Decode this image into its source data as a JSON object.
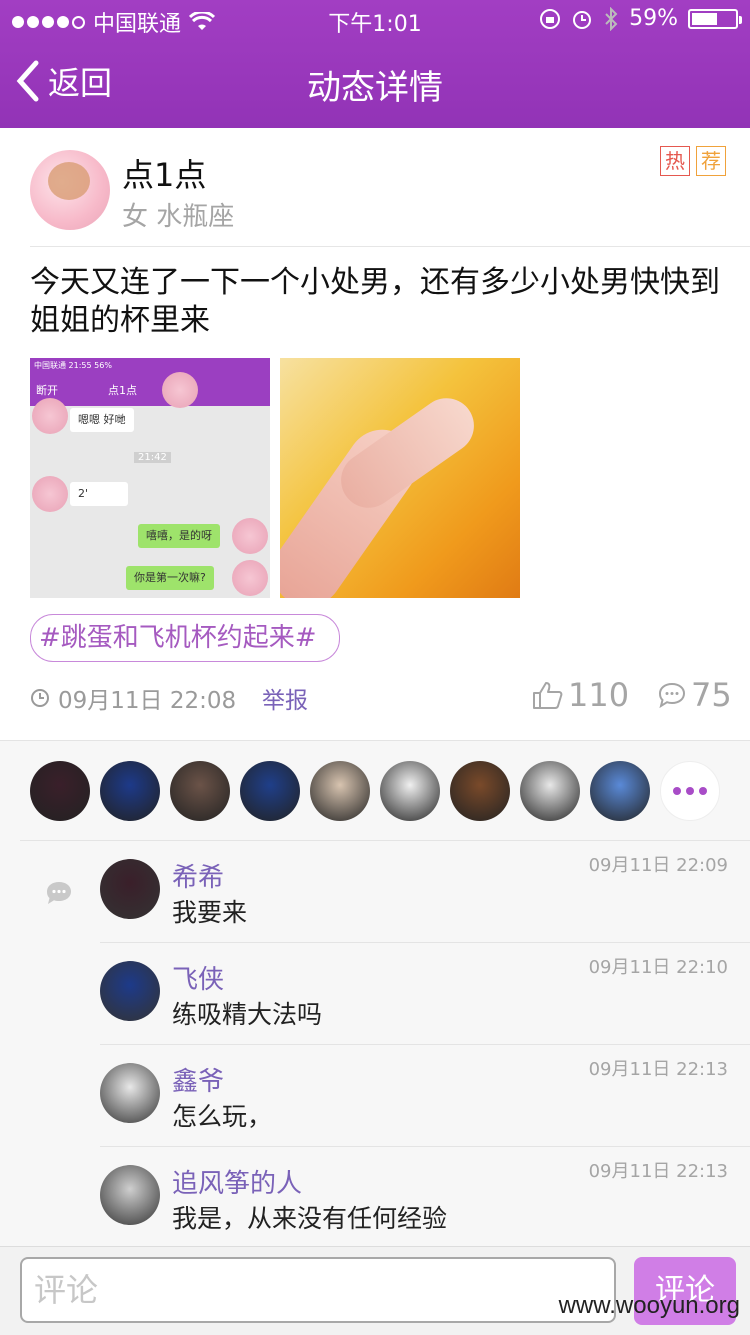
{
  "status_bar": {
    "carrier": "中国联通",
    "time": "下午1:01",
    "battery": "59%",
    "battery_level": 0.59
  },
  "nav": {
    "back_label": "返回",
    "title": "动态详情"
  },
  "post": {
    "username": "点1点",
    "gender": "女",
    "zodiac": "水瓶座",
    "badges": [
      "热",
      "荐"
    ],
    "content": "今天又连了一下一个小处男，还有多少小处男快快到姐姐的杯里来",
    "images": [
      {
        "status_carrier": "中国联通",
        "status_time": "21:55",
        "status_battery": "56%",
        "chat_left": "断开",
        "chat_title": "点1点",
        "chat_bubble1": "嗯嗯 好哋",
        "chat_time": "21:42",
        "chat_voice": "2'",
        "chat_bubble2": "嘻嘻，是的呀",
        "chat_bubble3": "你是第一次嘛?"
      },
      {}
    ],
    "tag": "#跳蛋和飞机杯约起来#",
    "time": "09月11日 22:08",
    "report": "举报",
    "likes": "110",
    "comments_count": "75"
  },
  "likers_colors": [
    "#3a1f2a",
    "#1d3a8a",
    "#6b5348",
    "#1f3f8a",
    "#d8c4b0",
    "#f0f0f0",
    "#7a4a2a",
    "#e8e8e8",
    "#5a8ad8"
  ],
  "comments": [
    {
      "name": "希希",
      "text": "我要来",
      "time": "09月11日 22:09",
      "color": "#3a1f2a"
    },
    {
      "name": "飞侠",
      "text": "练吸精大法吗",
      "time": "09月11日 22:10",
      "color": "#1d3a8a"
    },
    {
      "name": "鑫爷",
      "text": "怎么玩，",
      "time": "09月11日 22:13",
      "color": "#e8e8e8"
    },
    {
      "name": "追风筝的人",
      "text": "我是，从来没有任何经验",
      "time": "09月11日 22:13",
      "color": "#cfcfcf"
    }
  ],
  "input": {
    "placeholder": "评论",
    "send_label": "评论"
  },
  "watermark": "www.wooyun.org",
  "colors": {
    "header": "#9a38bd",
    "accent": "#7a62b8",
    "send": "#d07ee6"
  }
}
